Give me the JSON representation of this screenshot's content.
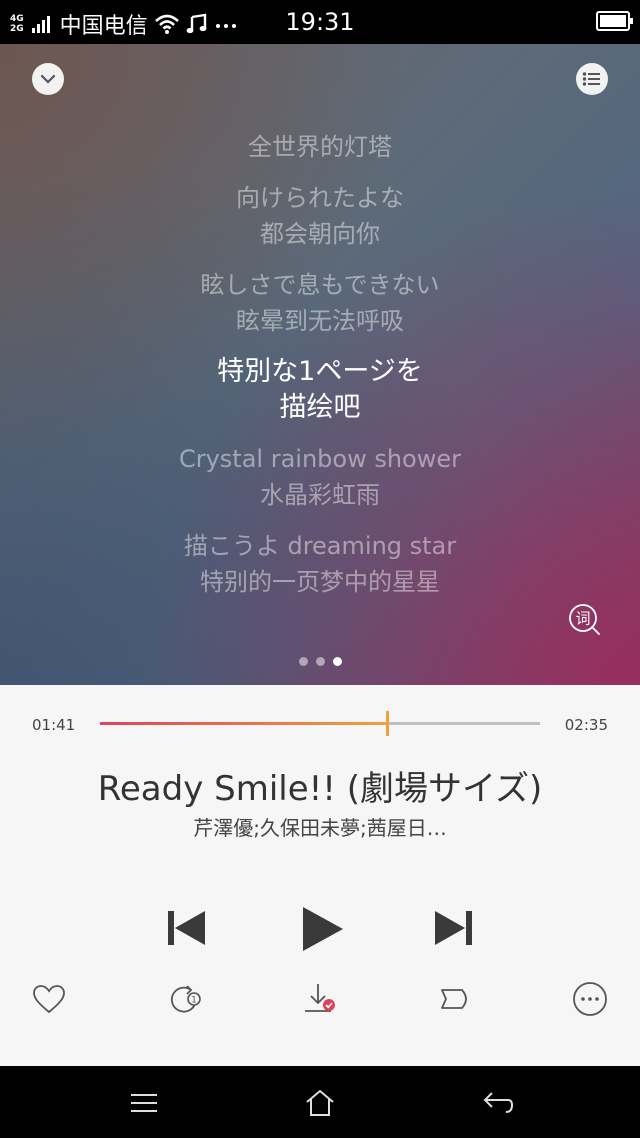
{
  "status_bar": {
    "network_top": "4G",
    "network_bottom": "2G",
    "carrier": "中国电信",
    "time": "19:31",
    "icons": [
      "signal-icon",
      "wifi-icon",
      "music-note-icon",
      "more-dots-icon",
      "battery-icon"
    ]
  },
  "lyrics": [
    {
      "lines": [
        "全世界的灯塔"
      ],
      "current": false
    },
    {
      "lines": [
        "向けられたよな",
        "都会朝向你"
      ],
      "current": false
    },
    {
      "lines": [
        "眩しさで息もできない",
        "眩晕到无法呼吸"
      ],
      "current": false
    },
    {
      "lines": [
        "特別な1ページを",
        "描绘吧"
      ],
      "current": true
    },
    {
      "lines": [
        "Crystal rainbow shower",
        "水晶彩虹雨"
      ],
      "current": false
    },
    {
      "lines": [
        "描こうよ dreaming star",
        "特别的一页梦中的星星"
      ],
      "current": false
    }
  ],
  "lyric_button_glyph": "词",
  "page_dots": {
    "count": 3,
    "active_index": 2
  },
  "player": {
    "elapsed": "01:41",
    "total": "02:35",
    "progress": 0.6516,
    "title": "Ready Smile!! (劇場サイズ)",
    "artist": "芹澤優;久保田未夢;茜屋日…"
  },
  "controls": [
    "previous-icon",
    "play-icon",
    "next-icon"
  ],
  "actions": [
    "heart-icon",
    "repeat-one-icon",
    "download-done-icon",
    "tag-icon",
    "more-icon"
  ],
  "colors": {
    "progress_start": "#e0425a",
    "progress_end": "#f0a040",
    "download_badge": "#e0425a"
  }
}
